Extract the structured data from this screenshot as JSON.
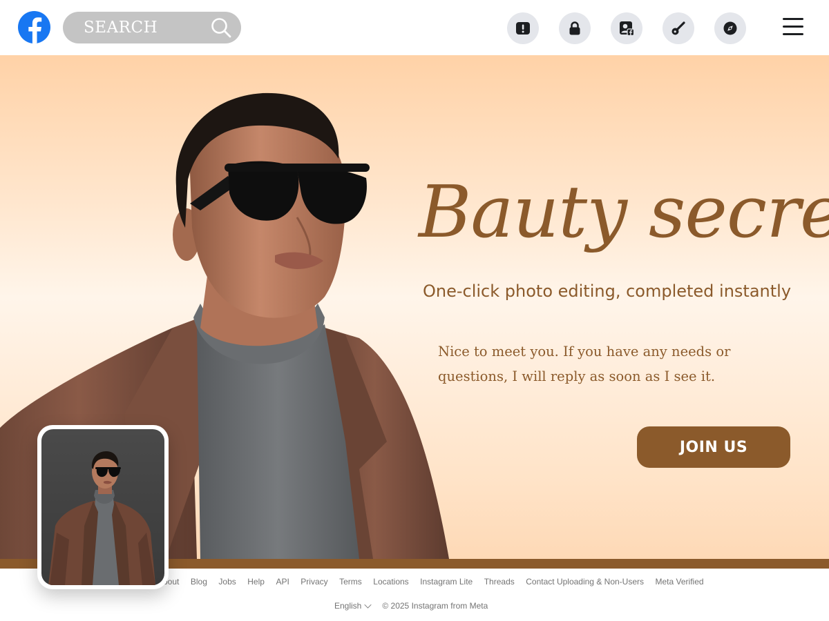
{
  "header": {
    "logo_icon": "facebook-logo-icon",
    "search": {
      "placeholder": "SEARCH",
      "icon": "search-icon"
    },
    "nav_icons": [
      {
        "name": "alert-icon"
      },
      {
        "name": "lock-icon"
      },
      {
        "name": "profile-facebook-icon"
      },
      {
        "name": "key-icon"
      },
      {
        "name": "compass-icon"
      }
    ],
    "menu_icon": "hamburger-menu-icon"
  },
  "hero": {
    "title": "Bauty secrets",
    "subtitle": "One-click photo editing, completed instantly",
    "description": "Nice to meet you. If you have any needs or questions, I will reply as soon as I see it.",
    "cta_label": "JOIN US"
  },
  "footer": {
    "links": [
      "About",
      "Blog",
      "Jobs",
      "Help",
      "API",
      "Privacy",
      "Terms",
      "Locations",
      "Instagram Lite",
      "Threads",
      "Contact Uploading & Non-Users",
      "Meta Verified"
    ],
    "language": "English",
    "copyright": "© 2025 Instagram from Meta"
  },
  "colors": {
    "facebook_blue": "#1877f2",
    "accent_brown": "#8b5a2b",
    "search_bg": "#c4c4c4",
    "icon_bg": "#e4e6eb",
    "hero_top": "#ffd2a7",
    "hero_mid": "#fff5ea"
  }
}
